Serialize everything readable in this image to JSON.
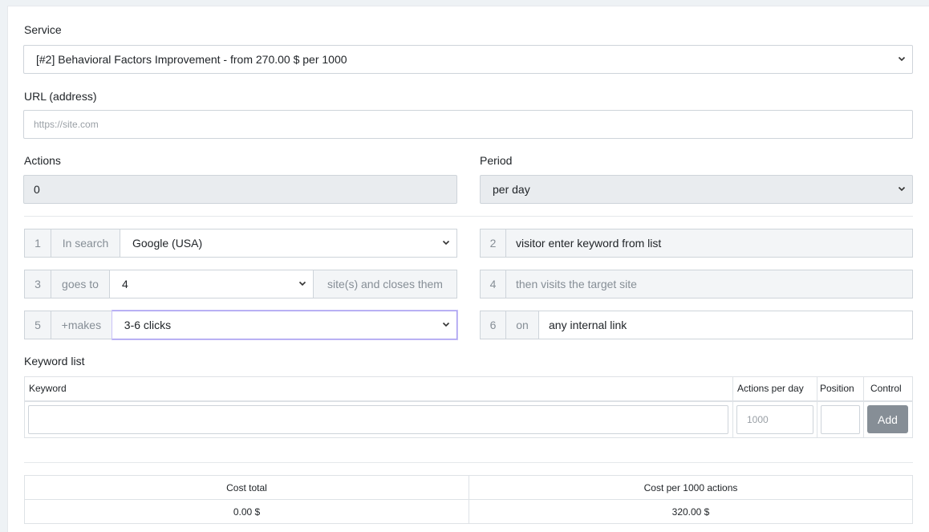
{
  "service": {
    "label": "Service",
    "selected": "[#2] Behavioral Factors Improvement - from 270.00 $ per 1000"
  },
  "url": {
    "label": "URL (address)",
    "placeholder": "https://site.com"
  },
  "actions": {
    "label": "Actions",
    "value": "0"
  },
  "period": {
    "label": "Period",
    "selected": "per day"
  },
  "steps": {
    "s1": {
      "num": "1",
      "prefix": "In search",
      "selected": "Google (USA)"
    },
    "s2": {
      "num": "2",
      "text": "visitor enter keyword from list"
    },
    "s3": {
      "num": "3",
      "prefix": "goes to",
      "selected": "4",
      "suffix": "site(s) and closes them"
    },
    "s4": {
      "num": "4",
      "text": "then visits the target site"
    },
    "s5": {
      "num": "5",
      "prefix": "+makes",
      "selected": "3-6 clicks"
    },
    "s6": {
      "num": "6",
      "prefix": "on",
      "text": "any internal link"
    }
  },
  "keywords": {
    "label": "Keyword list",
    "columns": [
      "Keyword",
      "Actions per day",
      "Position",
      "Control"
    ],
    "keyword_value": "",
    "actions_placeholder": "1000",
    "position_value": "",
    "add_label": "Add"
  },
  "summary": {
    "headers": [
      "Cost total",
      "Cost per 1000 actions"
    ],
    "values": [
      "0.00 $",
      "320.00 $"
    ]
  },
  "colors": {
    "accent_focus": "#a89ef0",
    "button": "#868e96",
    "readonly_bg": "#e9ecef"
  }
}
